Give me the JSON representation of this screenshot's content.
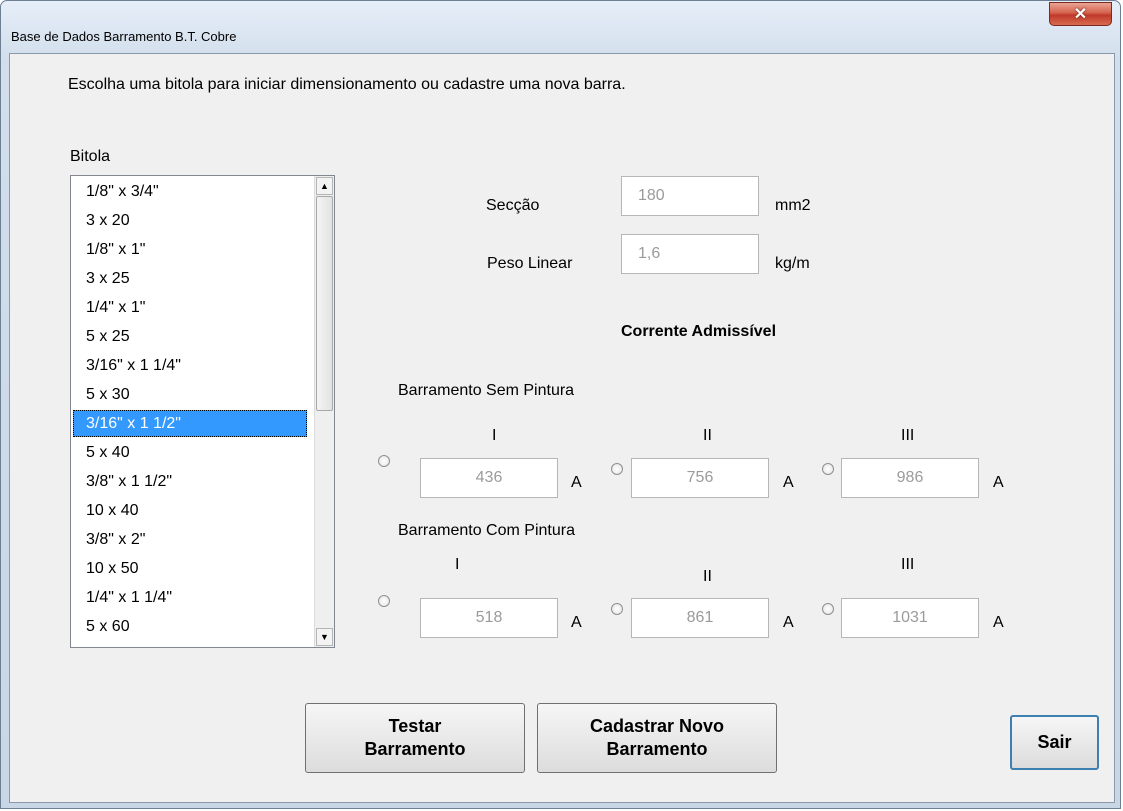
{
  "window": {
    "title": "Base de Dados Barramento B.T. Cobre",
    "close_icon": "x-close-icon"
  },
  "instruction": "Escolha uma bitola para iniciar dimensionamento ou cadastre uma nova barra.",
  "bitola": {
    "label": "Bitola",
    "items": [
      "1/8\" x 3/4\"",
      "3 x 20",
      "1/8\" x 1\"",
      "3 x 25",
      "1/4\" x 1\"",
      "5 x 25",
      "3/16\" x 1 1/4\"",
      "5 x 30",
      "3/16\" x 1 1/2\"",
      "5 x 40",
      "3/8\" x 1 1/2\"",
      "10 x 40",
      "3/8\" x 2\"",
      "10 x 50",
      "1/4\" x 1 1/4\"",
      "5 x 60"
    ],
    "selected": "3/16\" x 1 1/2\""
  },
  "props": {
    "seccao_label": "Secção",
    "seccao_value": "180",
    "seccao_unit": "mm2",
    "peso_label": "Peso Linear",
    "peso_value": "1,6",
    "peso_unit": "kg/m"
  },
  "corrente": {
    "title": "Corrente Admissível",
    "sem": {
      "label": "Barramento Sem Pintura",
      "headers": [
        "I",
        "II",
        "III"
      ],
      "values": [
        "436",
        "756",
        "986"
      ]
    },
    "com": {
      "label": "Barramento Com Pintura",
      "headers": [
        "I",
        "II",
        "III"
      ],
      "values": [
        "518",
        "861",
        "1031"
      ]
    },
    "unit": "A"
  },
  "buttons": {
    "testar": "Testar\nBarramento",
    "cadastrar": "Cadastrar Novo\nBarramento",
    "sair": "Sair"
  }
}
